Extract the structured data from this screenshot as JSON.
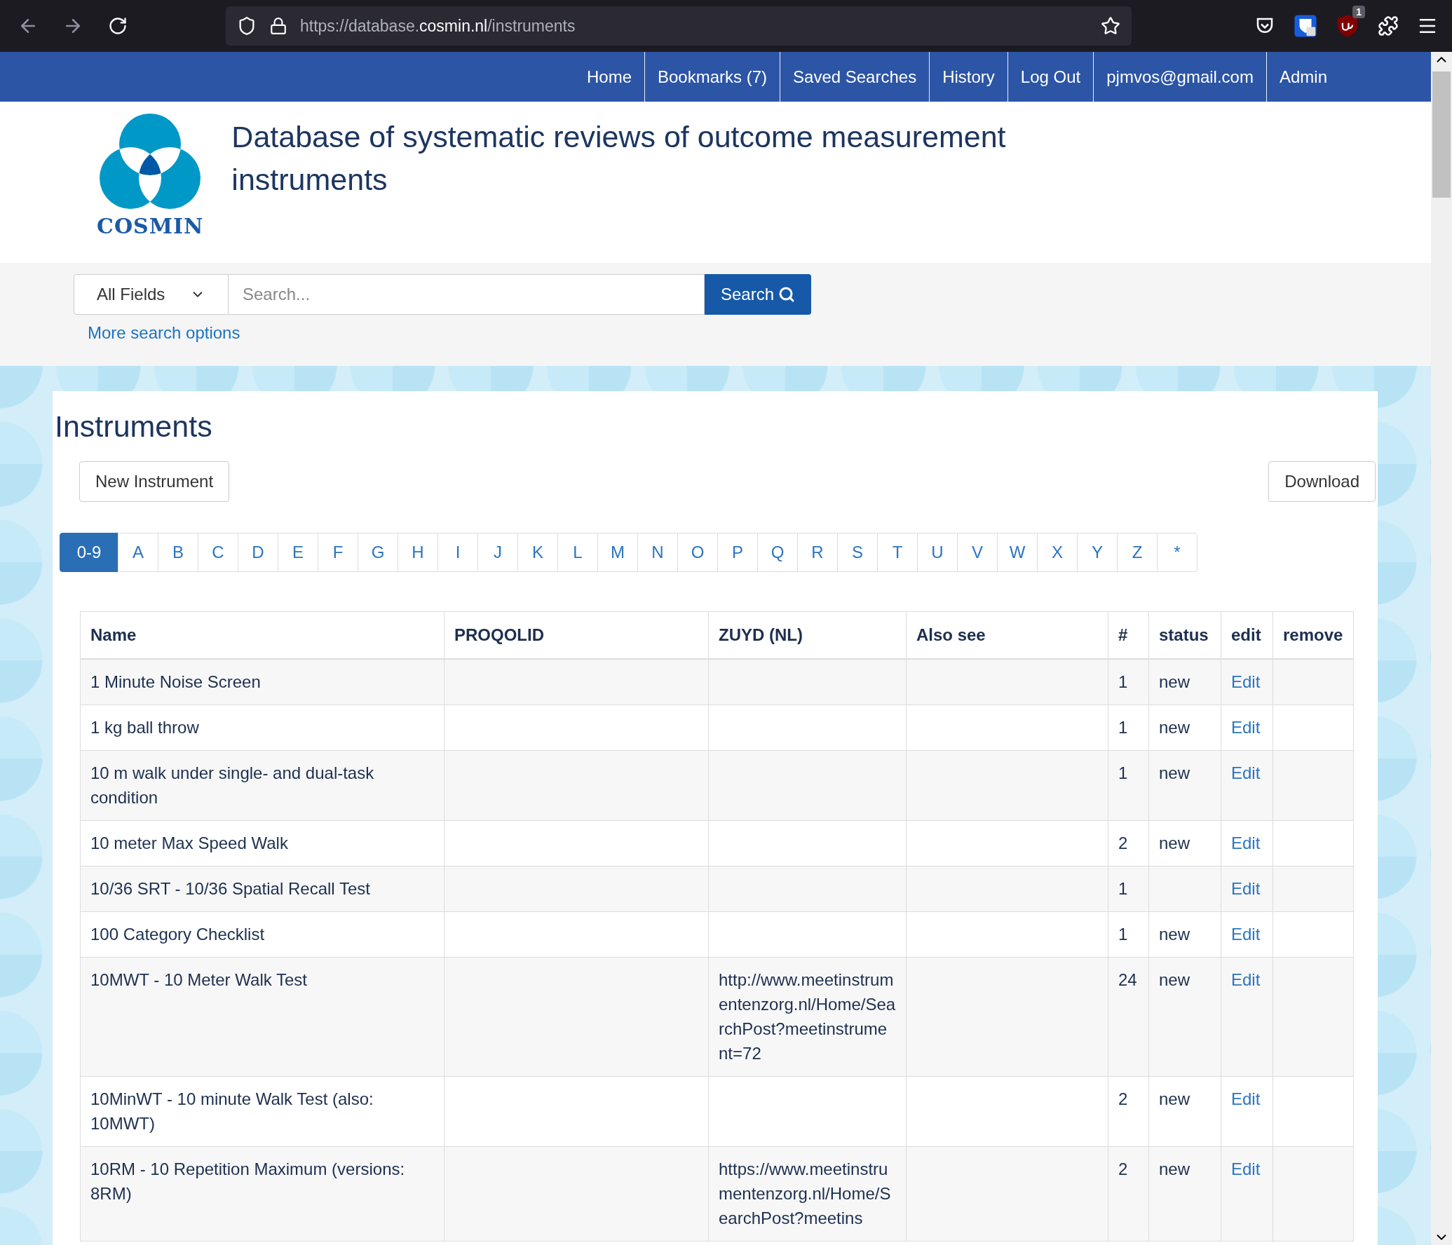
{
  "browser": {
    "url": "https://database.**cosmin.nl**/instruments",
    "extension_badge": "1"
  },
  "nav": [
    "Home",
    "Bookmarks (7)",
    "Saved Searches",
    "History",
    "Log Out",
    "pjmvos@gmail.com",
    "Admin"
  ],
  "site": {
    "logo_text": "COSMIN",
    "title": "Database of systematic reviews of outcome measurement instruments"
  },
  "search": {
    "field_select": "All Fields",
    "placeholder": "Search...",
    "button": "Search",
    "more_options": "More search options"
  },
  "page": {
    "heading": "Instruments",
    "new_button": "New Instrument",
    "download_button": "Download",
    "letters": [
      {
        "label": "0-9",
        "selected": true
      },
      {
        "label": "A",
        "selected": false
      },
      {
        "label": "B",
        "selected": false
      },
      {
        "label": "C",
        "selected": false
      },
      {
        "label": "D",
        "selected": false
      },
      {
        "label": "E",
        "selected": false
      },
      {
        "label": "F",
        "selected": false
      },
      {
        "label": "G",
        "selected": false
      },
      {
        "label": "H",
        "selected": false
      },
      {
        "label": "I",
        "selected": false
      },
      {
        "label": "J",
        "selected": false
      },
      {
        "label": "K",
        "selected": false
      },
      {
        "label": "L",
        "selected": false
      },
      {
        "label": "M",
        "selected": false
      },
      {
        "label": "N",
        "selected": false
      },
      {
        "label": "O",
        "selected": false
      },
      {
        "label": "P",
        "selected": false
      },
      {
        "label": "Q",
        "selected": false
      },
      {
        "label": "R",
        "selected": false
      },
      {
        "label": "S",
        "selected": false
      },
      {
        "label": "T",
        "selected": false
      },
      {
        "label": "U",
        "selected": false
      },
      {
        "label": "V",
        "selected": false
      },
      {
        "label": "W",
        "selected": false
      },
      {
        "label": "X",
        "selected": false
      },
      {
        "label": "Y",
        "selected": false
      },
      {
        "label": "Z",
        "selected": false
      },
      {
        "label": "*",
        "selected": false
      }
    ],
    "table": {
      "columns": [
        "Name",
        "PROQOLID",
        "ZUYD (NL)",
        "Also see",
        "#",
        "status",
        "edit",
        "remove"
      ],
      "rows": [
        {
          "name": "1 Minute Noise Screen",
          "zuyd": "",
          "count": "1",
          "status": "new",
          "edit": "Edit"
        },
        {
          "name": "1 kg ball throw",
          "zuyd": "",
          "count": "1",
          "status": "new",
          "edit": "Edit"
        },
        {
          "name": "10 m walk under single- and dual-task condition",
          "zuyd": "",
          "count": "1",
          "status": "new",
          "edit": "Edit"
        },
        {
          "name": "10 meter Max Speed Walk",
          "zuyd": "",
          "count": "2",
          "status": "new",
          "edit": "Edit"
        },
        {
          "name": "10/36 SRT - 10/36 Spatial Recall Test",
          "zuyd": "",
          "count": "1",
          "status": "",
          "edit": "Edit"
        },
        {
          "name": "100 Category Checklist",
          "zuyd": "",
          "count": "1",
          "status": "new",
          "edit": "Edit"
        },
        {
          "name": "10MWT - 10 Meter Walk Test",
          "zuyd": "http://www.meetinstrumentenzorg.nl/Home/SearchPost?meetinstrument=72",
          "count": "24",
          "status": "new",
          "edit": "Edit"
        },
        {
          "name": "10MinWT - 10 minute Walk Test (also: 10MWT)",
          "zuyd": "",
          "count": "2",
          "status": "new",
          "edit": "Edit"
        },
        {
          "name": "10RM - 10 Repetition Maximum (versions: 8RM)",
          "zuyd": "https://www.meetinstrumentenzorg.nl/Home/SearchPost?meetins",
          "count": "2",
          "status": "new",
          "edit": "Edit"
        }
      ]
    }
  }
}
